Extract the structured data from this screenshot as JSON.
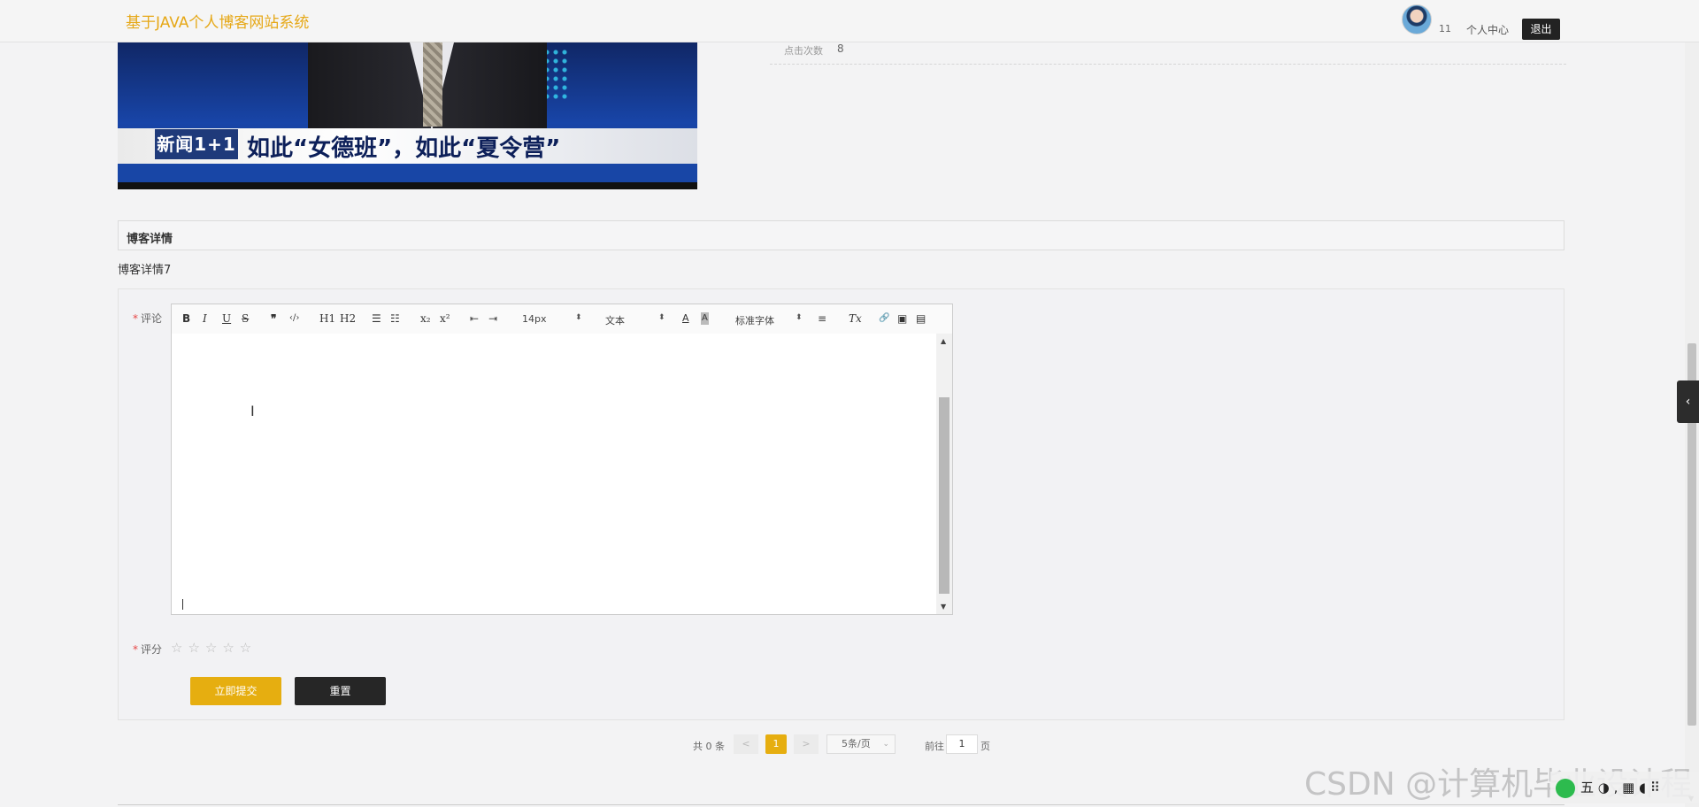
{
  "header": {
    "site_title": "基于JAVA个人博客网站系统",
    "user_count": "11",
    "user_center_label": "个人中心",
    "logout_label": "退出"
  },
  "blog_image": {
    "logo_text": "新闻1+1",
    "caption": "如此“女德班”，如此“夏令营”"
  },
  "stats": {
    "click_label": "点击次数",
    "click_value": "8"
  },
  "detail": {
    "section_title": "博客详情",
    "content": "博客详情7"
  },
  "comment_form": {
    "comment_label": "评论",
    "rating_label": "评分",
    "required_mark": "*",
    "editor_toolbar": {
      "bold": "B",
      "italic": "I",
      "underline": "U",
      "strike": "S",
      "quote": "❞",
      "code": "‹/›",
      "h1": "H1",
      "h2": "H2",
      "ordered_list": "☰",
      "bullet_list": "☷",
      "subscript": "x₂",
      "superscript": "x²",
      "outdent": "⇤",
      "indent": "⇥",
      "font_size": "14px",
      "header_type": "文本",
      "font_family": "标准字体",
      "align": "≡",
      "clean": "Tx",
      "link": "🔗",
      "image": "▣",
      "video": "▤"
    },
    "rating_stars": "☆☆☆☆☆",
    "rating_value": 0,
    "submit_label": "立即提交",
    "reset_label": "重置"
  },
  "pagination": {
    "total": "共 0 条",
    "prev": "<",
    "current_page": "1",
    "next": ">",
    "page_size": "5条/页",
    "goto_label": "前往",
    "goto_value": "1",
    "page_suffix": "页"
  },
  "overlay": {
    "side_toggle": "‹",
    "watermark": "CSDN @计算机毕业设计程",
    "tray_text": "五 ◑ , ▦ ◖ ⠿"
  },
  "colors": {
    "brand": "#e6a817",
    "primary_button": "#e6ae10",
    "dark_button": "#262626",
    "required": "#e64545"
  }
}
